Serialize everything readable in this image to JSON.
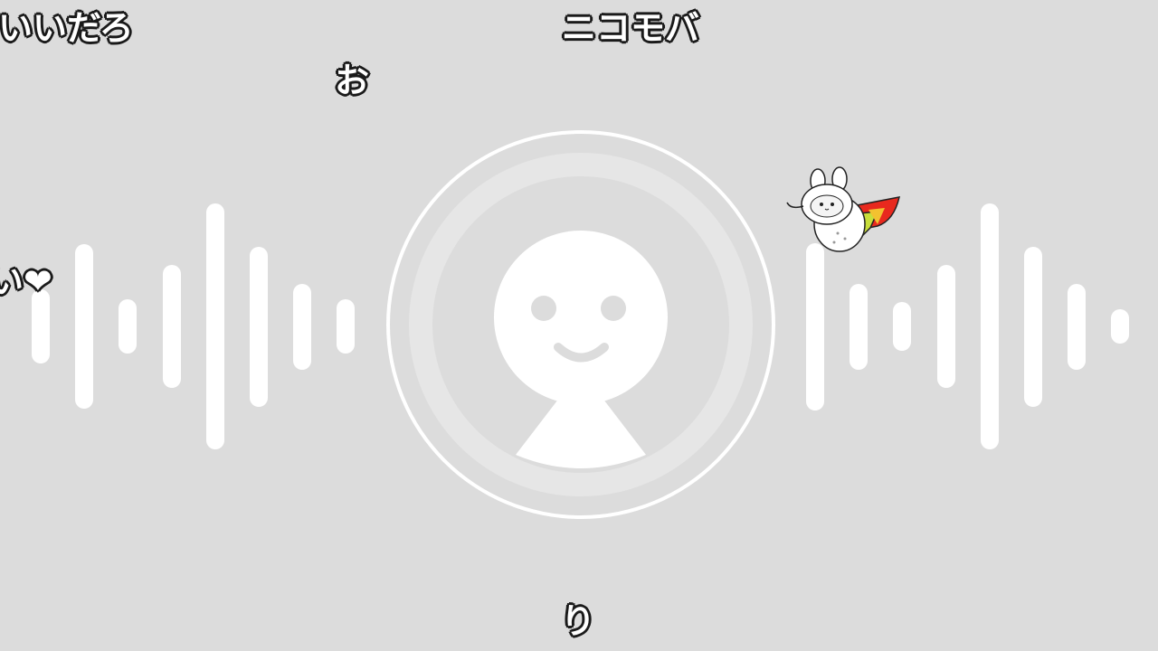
{
  "player": {
    "background_color": "#dcdcdc",
    "bar_color": "#ffffff",
    "avatar_icon": "default-user-avatar-icon",
    "mascot_icon": "flying-caped-rabbit-mascot-icon",
    "mascot_cape_colors": [
      "#e8291e",
      "#f2c230",
      "#c8de3a"
    ],
    "left_bars": [
      0.3,
      0.67,
      0.22,
      0.5,
      1.0,
      0.65,
      0.35,
      0.22
    ],
    "right_bars": [
      0.68,
      0.35,
      0.2,
      0.5,
      1.0,
      0.65,
      0.35,
      0.14
    ]
  },
  "comments": {
    "c1": "いいだろ",
    "c2": "ニコモバ",
    "c3": "お",
    "c4": "い❤",
    "c5": "り"
  }
}
